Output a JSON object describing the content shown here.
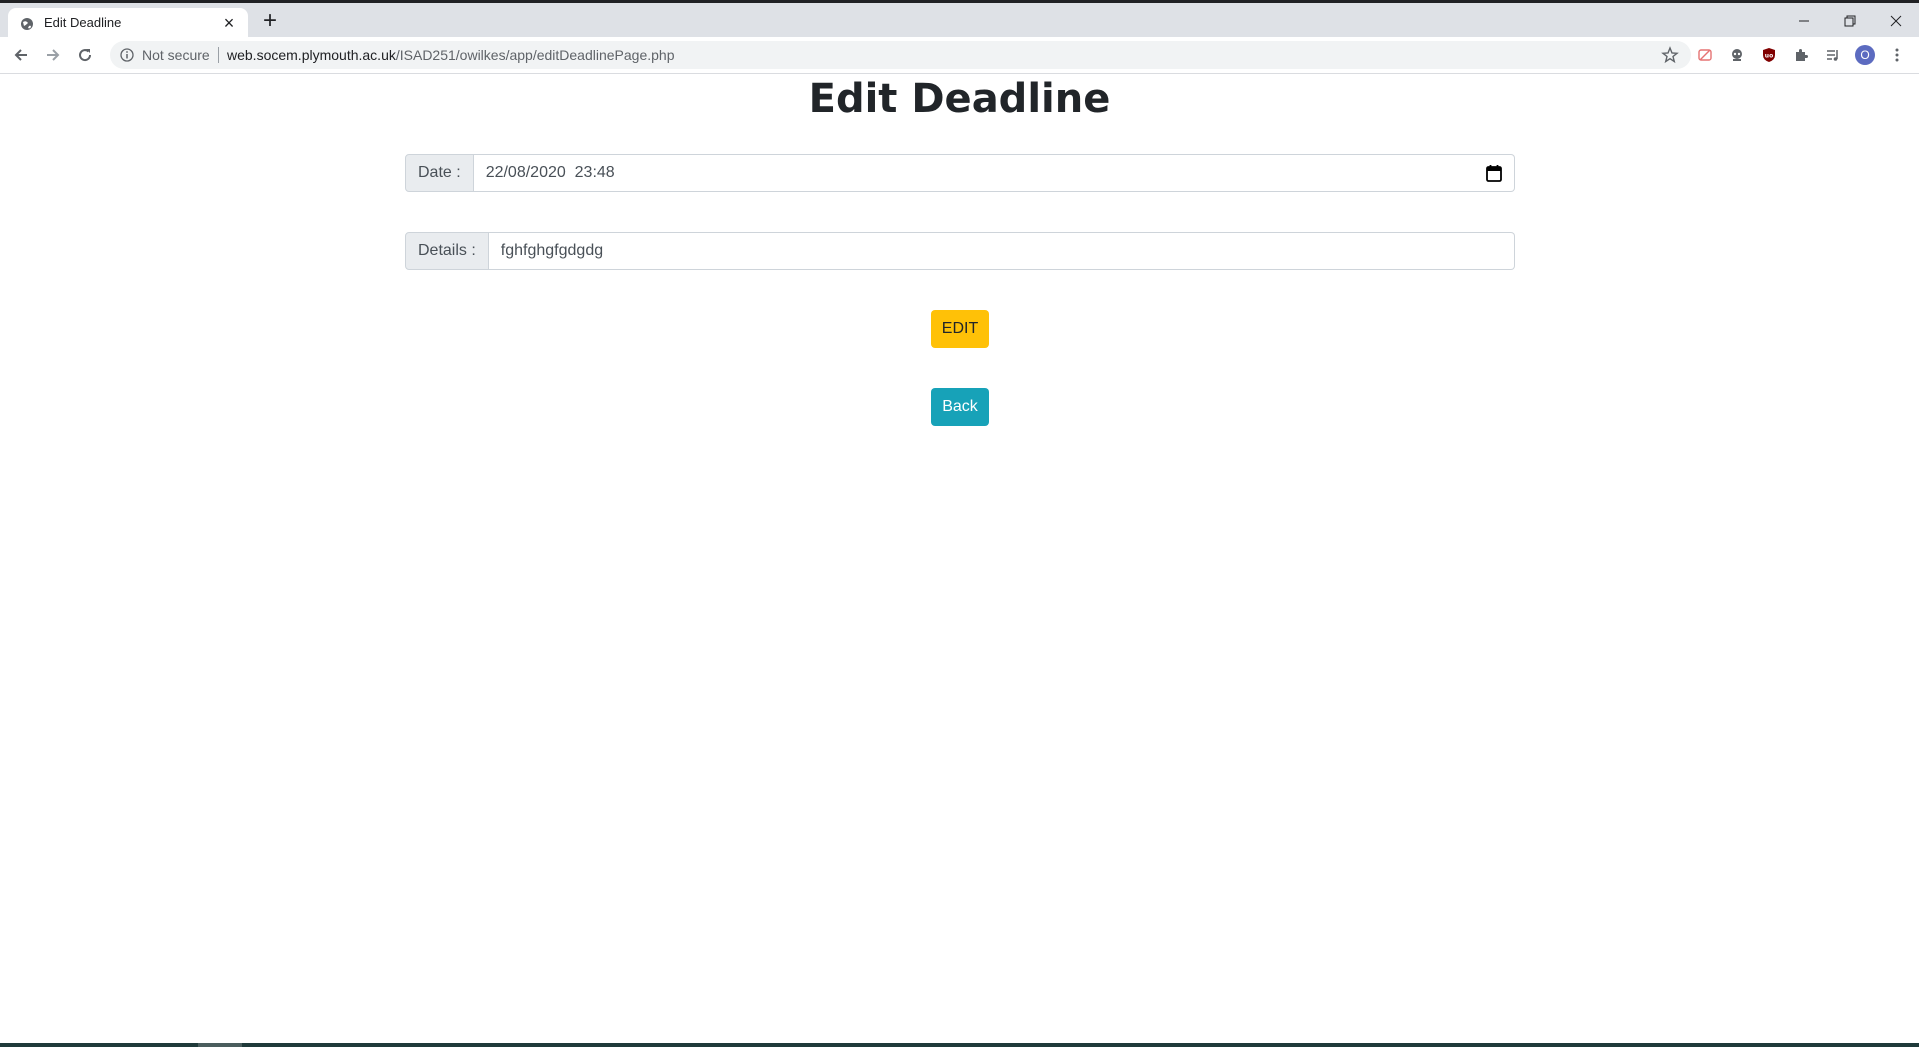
{
  "browser": {
    "tab_title": "Edit Deadline",
    "tab_close": "×",
    "new_tab": "+",
    "security_label": "Not secure",
    "url_host": "web.socem.plymouth.ac.uk",
    "url_path": "/ISAD251/owilkes/app/editDeadlinePage.php",
    "profile_initial": "O"
  },
  "page": {
    "title": "Edit Deadline",
    "date_label": "Date :",
    "date_value": "22/08/2020  23:48",
    "details_label": "Details :",
    "details_value": "fghfghgfgdgdg",
    "edit_button": "EDIT",
    "back_button": "Back"
  },
  "colors": {
    "edit_button": "#ffc107",
    "back_button": "#17a2b8",
    "title_text": "#212529"
  }
}
